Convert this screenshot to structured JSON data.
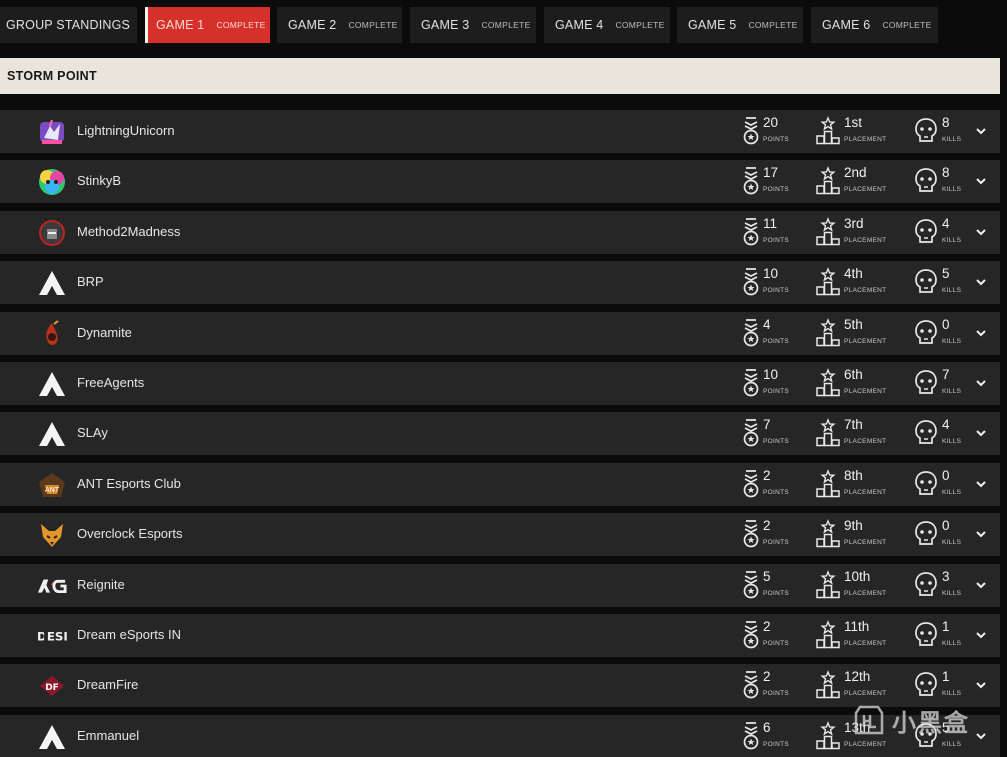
{
  "tabs": [
    {
      "title": "GROUP STANDINGS",
      "sub": ""
    },
    {
      "title": "GAME 1",
      "sub": "COMPLETE"
    },
    {
      "title": "GAME 2",
      "sub": "COMPLETE"
    },
    {
      "title": "GAME 3",
      "sub": "COMPLETE"
    },
    {
      "title": "GAME 4",
      "sub": "COMPLETE"
    },
    {
      "title": "GAME 5",
      "sub": "COMPLETE"
    },
    {
      "title": "GAME 6",
      "sub": "COMPLETE"
    }
  ],
  "active_tab": "GAME 1",
  "map_name": "STORM POINT",
  "labels": {
    "points": "POINTS",
    "placement": "PLACEMENT",
    "kills": "KILLS"
  },
  "teams": [
    {
      "name": "LightningUnicorn",
      "points": "20",
      "placement": "1st",
      "kills": "8",
      "logo": "unicorn-logo"
    },
    {
      "name": "StinkyB",
      "points": "17",
      "placement": "2nd",
      "kills": "8",
      "logo": "stinkyb-logo"
    },
    {
      "name": "Method2Madness",
      "points": "11",
      "placement": "3rd",
      "kills": "4",
      "logo": "m2m-logo"
    },
    {
      "name": "BRP",
      "points": "10",
      "placement": "4th",
      "kills": "5",
      "logo": "apex-logo"
    },
    {
      "name": "Dynamite",
      "points": "4",
      "placement": "5th",
      "kills": "0",
      "logo": "dynamite-logo"
    },
    {
      "name": "FreeAgents",
      "points": "10",
      "placement": "6th",
      "kills": "7",
      "logo": "apex-logo"
    },
    {
      "name": "SLAy",
      "points": "7",
      "placement": "7th",
      "kills": "4",
      "logo": "apex-logo"
    },
    {
      "name": "ANT Esports Club",
      "points": "2",
      "placement": "8th",
      "kills": "0",
      "logo": "ant-logo"
    },
    {
      "name": "Overclock Esports",
      "points": "2",
      "placement": "9th",
      "kills": "0",
      "logo": "fox-logo"
    },
    {
      "name": "Reignite",
      "points": "5",
      "placement": "10th",
      "kills": "3",
      "logo": "rg-logo"
    },
    {
      "name": "Dream eSports IN",
      "points": "2",
      "placement": "11th",
      "kills": "1",
      "logo": "desi-logo"
    },
    {
      "name": "DreamFire",
      "points": "2",
      "placement": "12th",
      "kills": "1",
      "logo": "df-logo"
    },
    {
      "name": "Emmanuel",
      "points": "6",
      "placement": "13th",
      "kills": "5",
      "logo": "apex-logo"
    }
  ],
  "watermark": "小黑盒",
  "colors": {
    "accent": "#d5312a",
    "row_bg": "#262626",
    "header_bg": "#e9e5dc"
  }
}
